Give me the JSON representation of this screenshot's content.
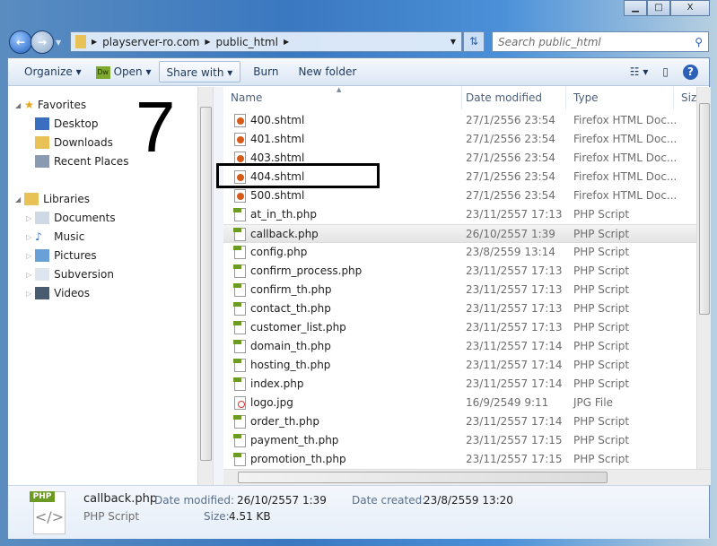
{
  "window": {
    "minimize": "▁",
    "maximize": "□",
    "close": "X"
  },
  "annotation": {
    "step_number": "7"
  },
  "address": {
    "segments": [
      "playserver-ro.com",
      "public_html"
    ],
    "search_placeholder": "Search public_html"
  },
  "toolbar": {
    "organize": "Organize",
    "open": "Open",
    "open_icon": "Dw",
    "share_with": "Share with",
    "burn": "Burn",
    "new_folder": "New folder"
  },
  "sidebar": {
    "favorites": {
      "label": "Favorites",
      "items": [
        "Desktop",
        "Downloads",
        "Recent Places"
      ]
    },
    "libraries": {
      "label": "Libraries",
      "items": [
        "Documents",
        "Music",
        "Pictures",
        "Subversion",
        "Videos"
      ]
    }
  },
  "columns": {
    "name": "Name",
    "date": "Date modified",
    "type": "Type",
    "size": "Size"
  },
  "files": [
    {
      "name": "400.shtml",
      "date": "27/1/2556 23:54",
      "type": "Firefox HTML Doc...",
      "icon": "ff"
    },
    {
      "name": "401.shtml",
      "date": "27/1/2556 23:54",
      "type": "Firefox HTML Doc...",
      "icon": "ff"
    },
    {
      "name": "403.shtml",
      "date": "27/1/2556 23:54",
      "type": "Firefox HTML Doc...",
      "icon": "ff"
    },
    {
      "name": "404.shtml",
      "date": "27/1/2556 23:54",
      "type": "Firefox HTML Doc...",
      "icon": "ff"
    },
    {
      "name": "500.shtml",
      "date": "27/1/2556 23:54",
      "type": "Firefox HTML Doc...",
      "icon": "ff"
    },
    {
      "name": "at_in_th.php",
      "date": "23/11/2557 17:13",
      "type": "PHP Script",
      "icon": "php"
    },
    {
      "name": "callback.php",
      "date": "26/10/2557 1:39",
      "type": "PHP Script",
      "icon": "php",
      "selected": true
    },
    {
      "name": "config.php",
      "date": "23/8/2559 13:14",
      "type": "PHP Script",
      "icon": "php"
    },
    {
      "name": "confirm_process.php",
      "date": "23/11/2557 17:13",
      "type": "PHP Script",
      "icon": "php"
    },
    {
      "name": "confirm_th.php",
      "date": "23/11/2557 17:13",
      "type": "PHP Script",
      "icon": "php"
    },
    {
      "name": "contact_th.php",
      "date": "23/11/2557 17:13",
      "type": "PHP Script",
      "icon": "php"
    },
    {
      "name": "customer_list.php",
      "date": "23/11/2557 17:13",
      "type": "PHP Script",
      "icon": "php"
    },
    {
      "name": "domain_th.php",
      "date": "23/11/2557 17:14",
      "type": "PHP Script",
      "icon": "php"
    },
    {
      "name": "hosting_th.php",
      "date": "23/11/2557 17:14",
      "type": "PHP Script",
      "icon": "php"
    },
    {
      "name": "index.php",
      "date": "23/11/2557 17:14",
      "type": "PHP Script",
      "icon": "php"
    },
    {
      "name": "logo.jpg",
      "date": "16/9/2549 9:11",
      "type": "JPG File",
      "icon": "jpg"
    },
    {
      "name": "order_th.php",
      "date": "23/11/2557 17:14",
      "type": "PHP Script",
      "icon": "php"
    },
    {
      "name": "payment_th.php",
      "date": "23/11/2557 17:15",
      "type": "PHP Script",
      "icon": "php"
    },
    {
      "name": "promotion_th.php",
      "date": "23/11/2557 17:15",
      "type": "PHP Script",
      "icon": "php"
    }
  ],
  "details": {
    "icon_label": "PHP",
    "name": "callback.php",
    "type": "PHP Script",
    "date_modified_label": "Date modified:",
    "date_modified": "26/10/2557 1:39",
    "date_created_label": "Date created:",
    "date_created": "23/8/2559 13:20",
    "size_label": "Size:",
    "size": "4.51 KB"
  }
}
